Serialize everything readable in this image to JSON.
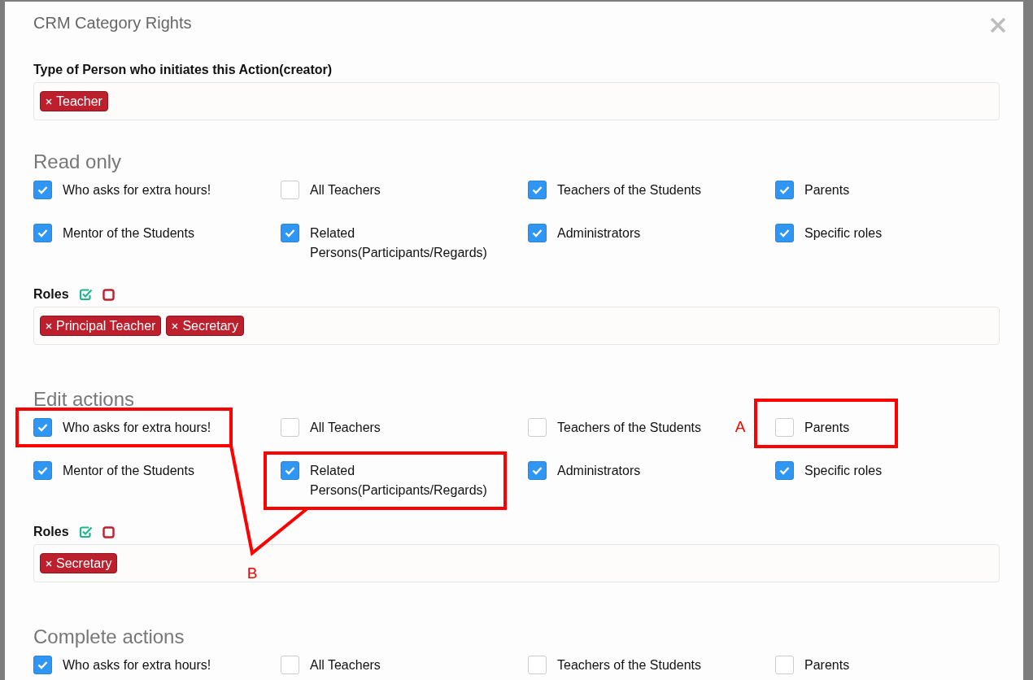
{
  "modal": {
    "title": "CRM Category Rights"
  },
  "creator": {
    "label": "Type of Person who initiates this Action(creator)",
    "tags": [
      "Teacher"
    ]
  },
  "sections": [
    {
      "heading": "Read only",
      "options": [
        {
          "label": "Who asks for extra hours!",
          "checked": true
        },
        {
          "label": "All Teachers",
          "checked": false
        },
        {
          "label": "Teachers of the Students",
          "checked": true
        },
        {
          "label": "Parents",
          "checked": true
        },
        {
          "label": "Mentor of the Students",
          "checked": true
        },
        {
          "label": "Related Persons(Participants/Regards)",
          "checked": true
        },
        {
          "label": "Administrators",
          "checked": true
        },
        {
          "label": "Specific roles",
          "checked": true
        }
      ],
      "roles": {
        "label": "Roles",
        "tags": [
          "Principal Teacher",
          "Secretary"
        ]
      }
    },
    {
      "heading": "Edit actions",
      "options": [
        {
          "label": "Who asks for extra hours!",
          "checked": true
        },
        {
          "label": "All Teachers",
          "checked": false
        },
        {
          "label": "Teachers of the Students",
          "checked": false
        },
        {
          "label": "Parents",
          "checked": false
        },
        {
          "label": "Mentor of the Students",
          "checked": true
        },
        {
          "label": "Related Persons(Participants/Regards)",
          "checked": true
        },
        {
          "label": "Administrators",
          "checked": true
        },
        {
          "label": "Specific roles",
          "checked": true
        }
      ],
      "roles": {
        "label": "Roles",
        "tags": [
          "Secretary"
        ]
      }
    },
    {
      "heading": "Complete actions",
      "options": [
        {
          "label": "Who asks for extra hours!",
          "checked": true
        },
        {
          "label": "All Teachers",
          "checked": false
        },
        {
          "label": "Teachers of the Students",
          "checked": false
        },
        {
          "label": "Parents",
          "checked": false
        }
      ]
    }
  ],
  "annotations": [
    {
      "label": "A"
    },
    {
      "label": "B"
    }
  ]
}
